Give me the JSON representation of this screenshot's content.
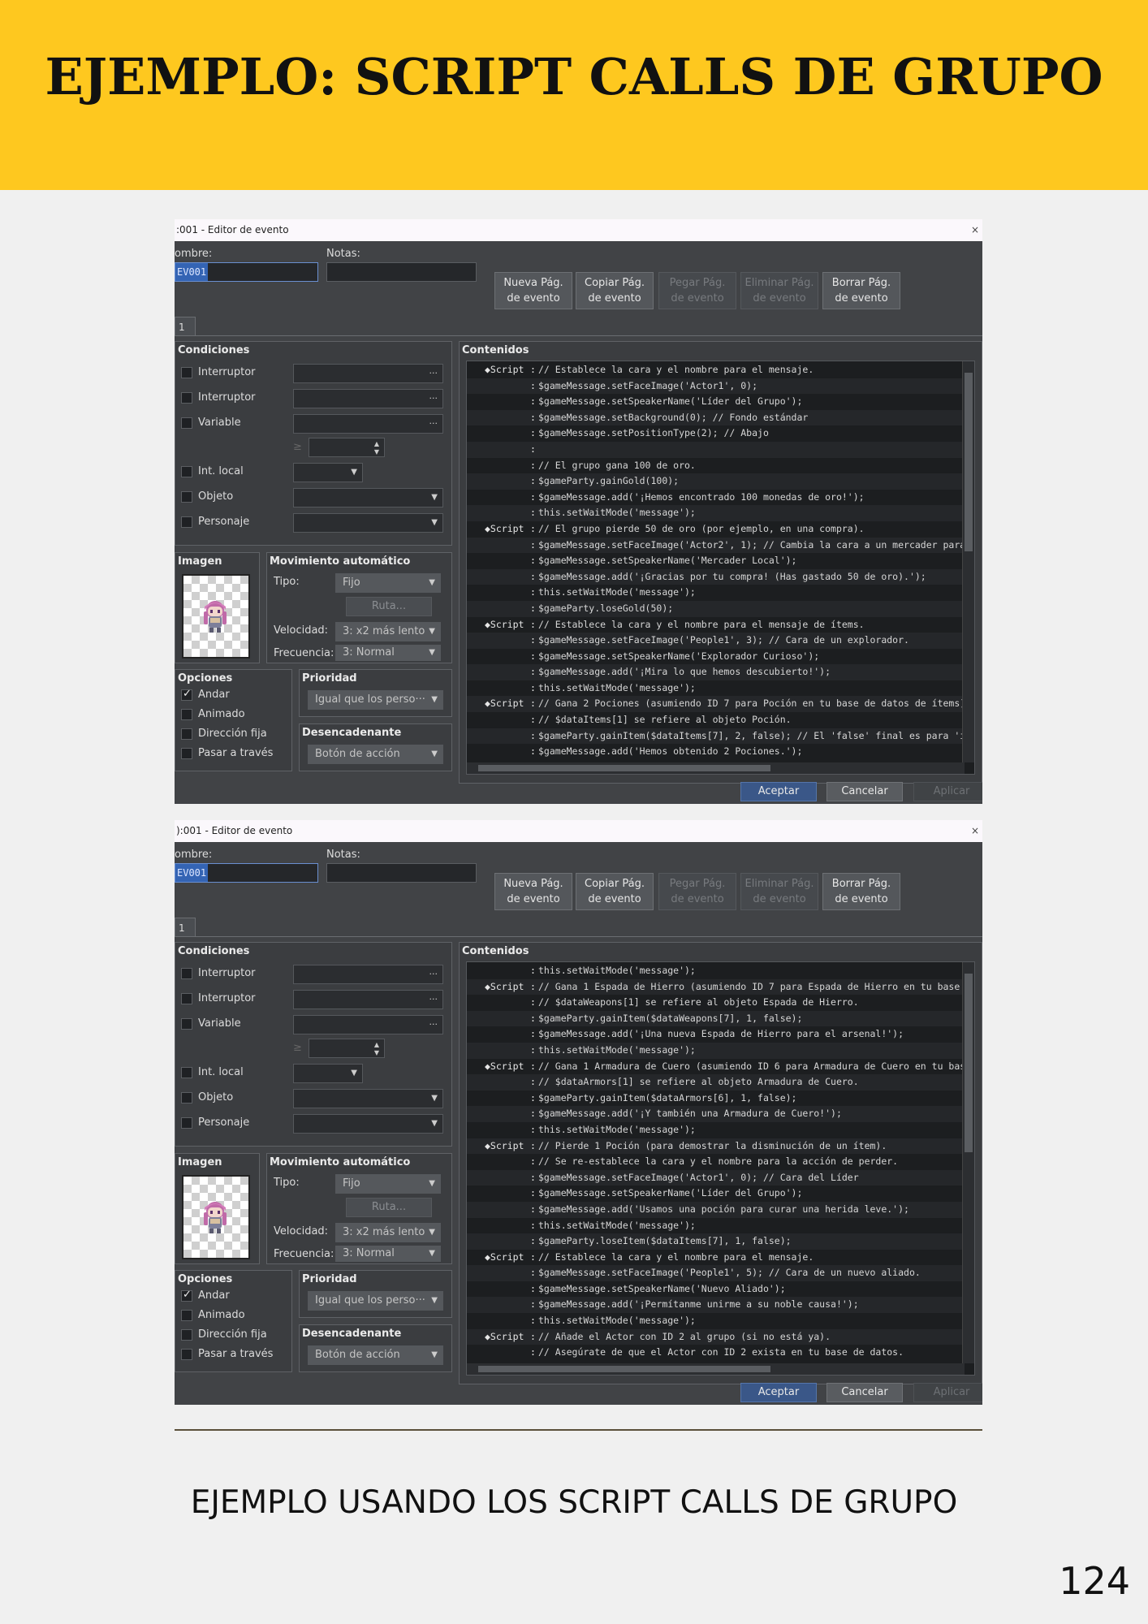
{
  "page": {
    "title": "EJEMPLO: SCRIPT CALLS DE GRUPO",
    "caption": "EJEMPLO USANDO LOS SCRIPT CALLS DE GRUPO",
    "page_number": "124"
  },
  "editor_common": {
    "name_label": "ombre:",
    "name_value": "EV001",
    "notes_label": "Notas:",
    "tab_label": "1",
    "buttons": {
      "new_page": [
        "Nueva Pág.",
        "de evento"
      ],
      "copy_page": [
        "Copiar Pág.",
        "de evento"
      ],
      "paste_page": [
        "Pegar Pág.",
        "de evento"
      ],
      "delete_page": [
        "Eliminar Pág.",
        "de evento"
      ],
      "clear_page": [
        "Borrar Pág.",
        "de evento"
      ]
    },
    "conditions": {
      "title": "Condiciones",
      "items": [
        "Interruptor",
        "Interruptor",
        "Variable",
        "Int. local",
        "Objeto",
        "Personaje"
      ],
      "dots": "···",
      "ge": "≥"
    },
    "image_title": "Imagen",
    "autonomous": {
      "title": "Movimiento automático",
      "type_label": "Tipo:",
      "type_value": "Fijo",
      "route_label": "Ruta...",
      "speed_label": "Velocidad:",
      "speed_value": "3: x2 más lento",
      "freq_label": "Frecuencia:",
      "freq_value": "3: Normal"
    },
    "options": {
      "title": "Opciones",
      "items": [
        {
          "label": "Andar",
          "checked": true
        },
        {
          "label": "Animado",
          "checked": false
        },
        {
          "label": "Dirección fija",
          "checked": false
        },
        {
          "label": "Pasar a través",
          "checked": false
        }
      ]
    },
    "priority": {
      "title": "Prioridad",
      "value": "Igual que los perso···"
    },
    "trigger": {
      "title": "Desencadenante",
      "value": "Botón de acción"
    },
    "contents_title": "Contenidos",
    "ok": "Aceptar",
    "cancel": "Cancelar",
    "apply": "Aplicar",
    "close_icon": "×"
  },
  "window1": {
    "titlebar": ":001 - Editor de evento",
    "lines": [
      [
        "◆Script",
        ":",
        "// Establece la cara y el nombre para el mensaje."
      ],
      [
        "",
        ":",
        "$gameMessage.setFaceImage('Actor1', 0);"
      ],
      [
        "",
        ":",
        "$gameMessage.setSpeakerName('Líder del Grupo');"
      ],
      [
        "",
        ":",
        "$gameMessage.setBackground(0); // Fondo estándar"
      ],
      [
        "",
        ":",
        "$gameMessage.setPositionType(2); // Abajo"
      ],
      [
        "",
        ":",
        ""
      ],
      [
        "",
        ":",
        "// El grupo gana 100 de oro."
      ],
      [
        "",
        ":",
        "$gameParty.gainGold(100);"
      ],
      [
        "",
        ":",
        "$gameMessage.add('¡Hemos encontrado 100 monedas de oro!');"
      ],
      [
        "",
        ":",
        "this.setWaitMode('message');"
      ],
      [
        "◆Script",
        ":",
        "// El grupo pierde 50 de oro (por ejemplo, en una compra)."
      ],
      [
        "",
        ":",
        "$gameMessage.setFaceImage('Actor2', 1); // Cambia la cara a un mercader para"
      ],
      [
        "",
        ":",
        "$gameMessage.setSpeakerName('Mercader Local');"
      ],
      [
        "",
        ":",
        "$gameMessage.add('¡Gracias por tu compra! (Has gastado 50 de oro).');"
      ],
      [
        "",
        ":",
        "this.setWaitMode('message');"
      ],
      [
        "",
        ":",
        "$gameParty.loseGold(50);"
      ],
      [
        "◆Script",
        ":",
        "// Establece la cara y el nombre para el mensaje de ítems."
      ],
      [
        "",
        ":",
        "$gameMessage.setFaceImage('People1', 3); // Cara de un explorador."
      ],
      [
        "",
        ":",
        "$gameMessage.setSpeakerName('Explorador Curioso');"
      ],
      [
        "",
        ":",
        "$gameMessage.add('¡Mira lo que hemos descubierto!');"
      ],
      [
        "",
        ":",
        "this.setWaitMode('message');"
      ],
      [
        "◆Script",
        ":",
        "// Gana 2 Pociones (asumiendo ID 7 para Poción en tu base de datos de ítems)"
      ],
      [
        "",
        ":",
        "// $dataItems[1] se refiere al objeto Poción."
      ],
      [
        "",
        ":",
        "$gameParty.gainItem($dataItems[7], 2, false); // El 'false' final es para 'i"
      ],
      [
        "",
        ":",
        "$gameMessage.add('Hemos obtenido 2 Pociones.');"
      ]
    ]
  },
  "window2": {
    "titlebar": "):001 - Editor de evento",
    "lines": [
      [
        "",
        ":",
        "this.setWaitMode('message');"
      ],
      [
        "◆Script",
        ":",
        "// Gana 1 Espada de Hierro (asumiendo ID 7 para Espada de Hierro en tu base"
      ],
      [
        "",
        ":",
        "// $dataWeapons[1] se refiere al objeto Espada de Hierro."
      ],
      [
        "",
        ":",
        "$gameParty.gainItem($dataWeapons[7], 1, false);"
      ],
      [
        "",
        ":",
        "$gameMessage.add('¡Una nueva Espada de Hierro para el arsenal!');"
      ],
      [
        "",
        ":",
        "this.setWaitMode('message');"
      ],
      [
        "◆Script",
        ":",
        "// Gana 1 Armadura de Cuero (asumiendo ID 6 para Armadura de Cuero en tu bas"
      ],
      [
        "",
        ":",
        "// $dataArmors[1] se refiere al objeto Armadura de Cuero."
      ],
      [
        "",
        ":",
        "$gameParty.gainItem($dataArmors[6], 1, false);"
      ],
      [
        "",
        ":",
        "$gameMessage.add('¡Y también una Armadura de Cuero!');"
      ],
      [
        "",
        ":",
        "this.setWaitMode('message');"
      ],
      [
        "◆Script",
        ":",
        "// Pierde 1 Poción (para demostrar la disminución de un ítem)."
      ],
      [
        "",
        ":",
        "// Se re-establece la cara y el nombre para la acción de perder."
      ],
      [
        "",
        ":",
        "$gameMessage.setFaceImage('Actor1', 0); // Cara del Líder"
      ],
      [
        "",
        ":",
        "$gameMessage.setSpeakerName('Líder del Grupo');"
      ],
      [
        "",
        ":",
        "$gameMessage.add('Usamos una poción para curar una herida leve.');"
      ],
      [
        "",
        ":",
        "this.setWaitMode('message');"
      ],
      [
        "",
        ":",
        "$gameParty.loseItem($dataItems[7], 1, false);"
      ],
      [
        "◆Script",
        ":",
        "// Establece la cara y el nombre para el mensaje."
      ],
      [
        "",
        ":",
        "$gameMessage.setFaceImage('People1', 5); // Cara de un nuevo aliado."
      ],
      [
        "",
        ":",
        "$gameMessage.setSpeakerName('Nuevo Aliado');"
      ],
      [
        "",
        ":",
        "$gameMessage.add('¡Permítanme unirme a su noble causa!');"
      ],
      [
        "",
        ":",
        "this.setWaitMode('message');"
      ],
      [
        "◆Script",
        ":",
        "// Añade el Actor con ID 2 al grupo (si no está ya)."
      ],
      [
        "",
        ":",
        "// Asegúrate de que el Actor con ID 2 exista en tu base de datos."
      ]
    ]
  }
}
